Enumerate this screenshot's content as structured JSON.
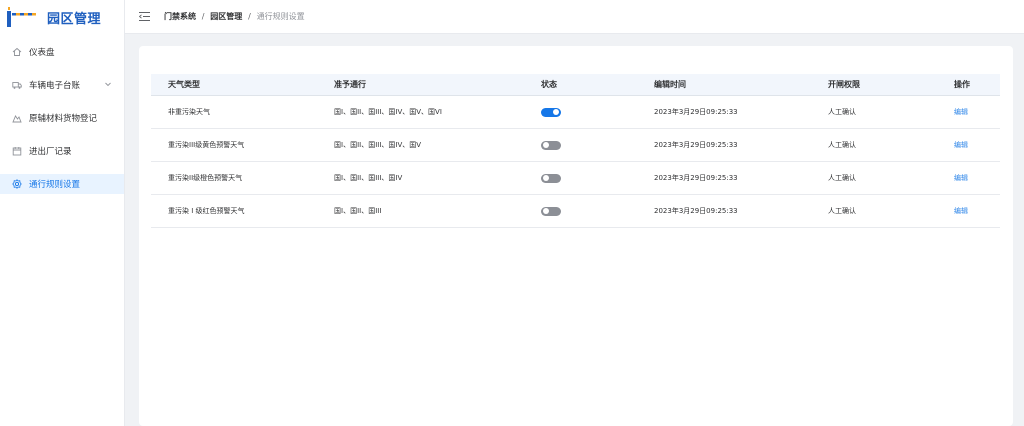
{
  "app": {
    "title": "园区管理"
  },
  "sidebar": {
    "items": [
      {
        "label": "仪表盘",
        "icon": "home-icon"
      },
      {
        "label": "车辆电子台账",
        "icon": "truck-icon",
        "chevron": "chevron-down-icon"
      },
      {
        "label": "原辅材料货物登记",
        "icon": "materials-icon"
      },
      {
        "label": "进出厂记录",
        "icon": "calendar-icon"
      },
      {
        "label": "通行规则设置",
        "icon": "gear-icon",
        "active": true
      }
    ]
  },
  "header": {
    "breadcrumb": [
      "门禁系统",
      "园区管理",
      "通行规则设置"
    ],
    "separator": "/"
  },
  "table": {
    "columns": [
      "天气类型",
      "准予通行",
      "状态",
      "编辑时间",
      "开闸权限",
      "操作"
    ],
    "rows": [
      {
        "weather": "非重污染天气",
        "allowed": "国I、国II、国III、国IV、国V、国VI",
        "status_on": true,
        "edited": "2023年3月29日09:25:33",
        "gate": "人工确认",
        "action": "编辑"
      },
      {
        "weather": "重污染III级黄色预警天气",
        "allowed": "国I、国II、国III、国IV、国V",
        "status_on": false,
        "edited": "2023年3月29日09:25:33",
        "gate": "人工确认",
        "action": "编辑"
      },
      {
        "weather": "重污染II级橙色预警天气",
        "allowed": "国I、国II、国III、国IV",
        "status_on": false,
        "edited": "2023年3月29日09:25:33",
        "gate": "人工确认",
        "action": "编辑"
      },
      {
        "weather": "重污染 I 级红色预警天气",
        "allowed": "国I、国II、国III",
        "status_on": false,
        "edited": "2023年3月29日09:25:33",
        "gate": "人工确认",
        "action": "编辑"
      }
    ]
  },
  "colors": {
    "accent": "#1677e8",
    "brand": "#1f5fbf",
    "link": "#2b84e8",
    "logo_orange": "#f5a623"
  }
}
